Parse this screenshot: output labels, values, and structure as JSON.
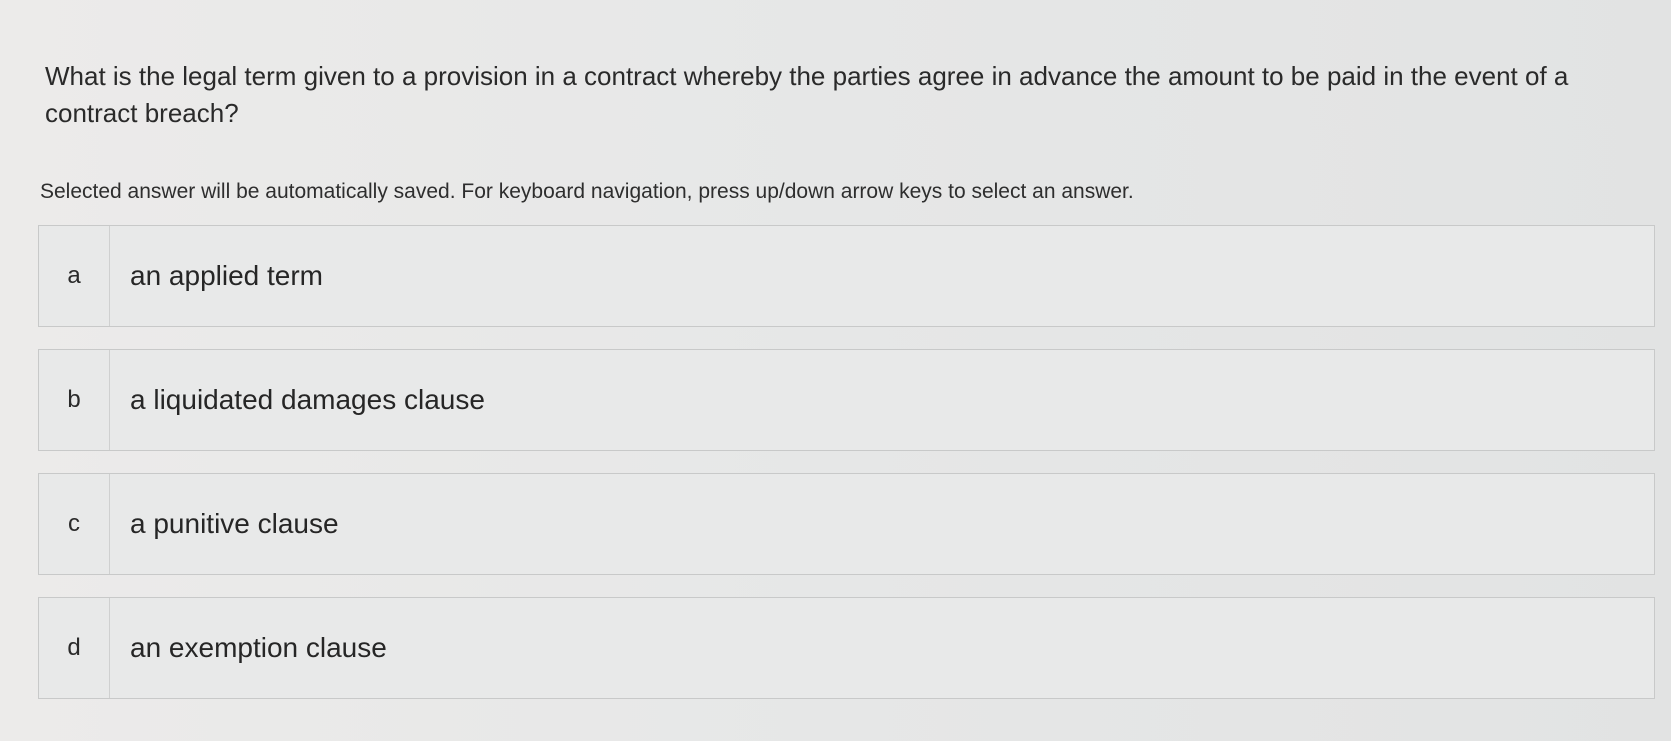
{
  "question": {
    "text": "What is the legal term given to a provision in a contract whereby the parties agree in advance the amount to be paid in the event of a contract breach?"
  },
  "instructions": {
    "text": "Selected answer will be automatically saved. For keyboard navigation, press up/down arrow keys to select an answer."
  },
  "options": [
    {
      "letter": "a",
      "text": "an applied term"
    },
    {
      "letter": "b",
      "text": "a liquidated damages clause"
    },
    {
      "letter": "c",
      "text": "a punitive clause"
    },
    {
      "letter": "d",
      "text": "an exemption clause"
    }
  ]
}
